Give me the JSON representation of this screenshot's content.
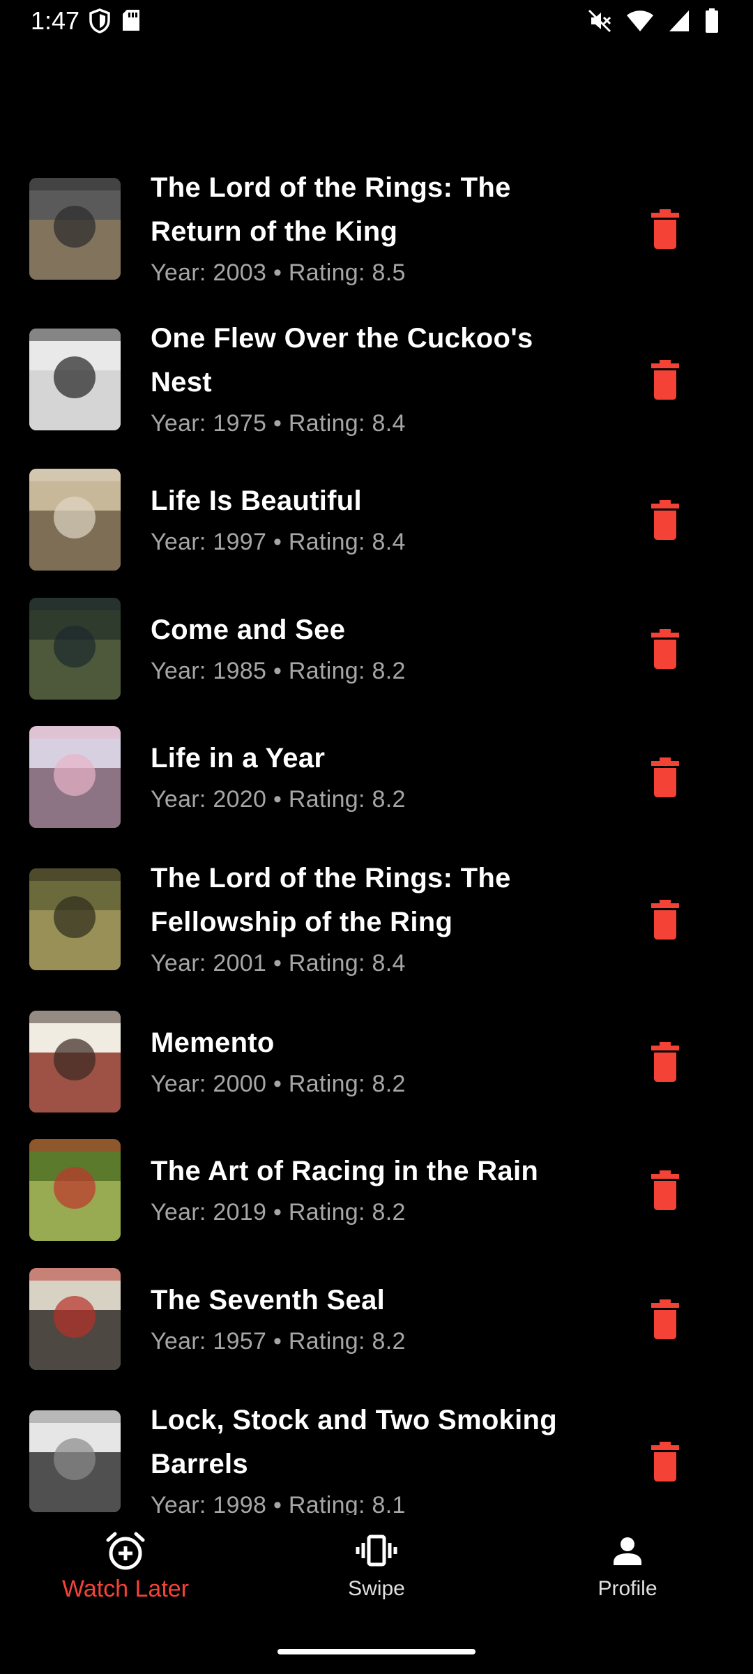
{
  "status_bar": {
    "time": "1:47",
    "left_icons": [
      "shield-icon",
      "sd-card-icon"
    ],
    "right_icons": [
      "mute-icon",
      "wifi-icon",
      "signal-icon",
      "battery-icon"
    ]
  },
  "movies": [
    {
      "title": "The Lord of the Rings: The Return of the King",
      "meta": "Year: 2003 • Rating: 8.5"
    },
    {
      "title": "One Flew Over the Cuckoo's Nest",
      "meta": "Year: 1975 • Rating: 8.4"
    },
    {
      "title": "Life Is Beautiful",
      "meta": "Year: 1997 • Rating: 8.4"
    },
    {
      "title": "Come and See",
      "meta": "Year: 1985 • Rating: 8.2"
    },
    {
      "title": "Life in a Year",
      "meta": "Year: 2020 • Rating: 8.2"
    },
    {
      "title": "The Lord of the Rings: The Fellowship of the Ring",
      "meta": "Year: 2001 • Rating: 8.4"
    },
    {
      "title": "Memento",
      "meta": "Year: 2000 • Rating: 8.2"
    },
    {
      "title": "The Art of Racing in the Rain",
      "meta": "Year: 2019 • Rating: 8.2"
    },
    {
      "title": "The Seventh Seal",
      "meta": "Year: 1957 • Rating: 8.2"
    },
    {
      "title": "Lock, Stock and Two Smoking Barrels",
      "meta": "Year: 1998 • Rating: 8.1"
    }
  ],
  "nav": {
    "items": [
      {
        "label": "Watch Later",
        "icon": "alarm-add-icon",
        "active": true
      },
      {
        "label": "Swipe",
        "icon": "vibration-icon",
        "active": false
      },
      {
        "label": "Profile",
        "icon": "person-icon",
        "active": false
      }
    ]
  },
  "colors": {
    "accent": "#f44336",
    "background": "#000000",
    "meta_text": "#a6a6a6"
  }
}
